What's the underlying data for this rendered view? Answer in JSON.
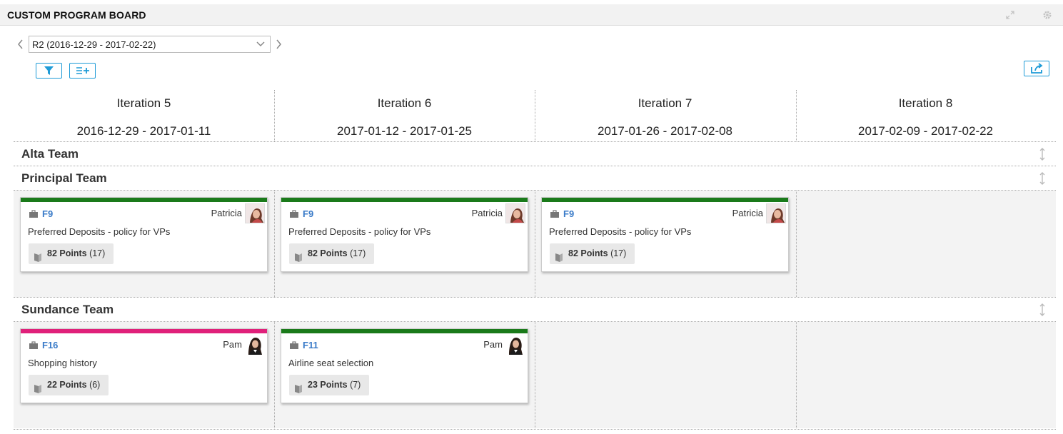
{
  "window": {
    "title": "CUSTOM PROGRAM BOARD",
    "expand_icon": "expand-icon",
    "settings_icon": "gear-icon"
  },
  "release": {
    "selected": "R2 (2016-12-29 - 2017-02-22)",
    "prev_icon": "chevron-left-icon",
    "next_icon": "chevron-right-icon"
  },
  "toolbar": {
    "filter_icon": "filter-icon",
    "add_row_icon": "add-list-icon",
    "share_icon": "share-icon",
    "accent_color": "#1e9bd7"
  },
  "iterations": [
    {
      "name": "Iteration 5",
      "dates": "2016-12-29 - 2017-01-11"
    },
    {
      "name": "Iteration 6",
      "dates": "2017-01-12 - 2017-01-25"
    },
    {
      "name": "Iteration 7",
      "dates": "2017-01-26 - 2017-02-08"
    },
    {
      "name": "Iteration 8",
      "dates": "2017-02-09 - 2017-02-22"
    }
  ],
  "teams": [
    {
      "name": "Alta Team",
      "cards": []
    },
    {
      "name": "Principal Team",
      "cards": [
        {
          "iteration": 0,
          "id": "F9",
          "owner": "Patricia",
          "title": "Preferred Deposits - policy for VPs",
          "points": "82 Points",
          "count": "(17)",
          "color": "#1a7a1a"
        },
        {
          "iteration": 1,
          "id": "F9",
          "owner": "Patricia",
          "title": "Preferred Deposits - policy for VPs",
          "points": "82 Points",
          "count": "(17)",
          "color": "#1a7a1a"
        },
        {
          "iteration": 2,
          "id": "F9",
          "owner": "Patricia",
          "title": "Preferred Deposits - policy for VPs",
          "points": "82 Points",
          "count": "(17)",
          "color": "#1a7a1a"
        }
      ]
    },
    {
      "name": "Sundance Team",
      "cards": [
        {
          "iteration": 0,
          "id": "F16",
          "owner": "Pam",
          "title": "Shopping history",
          "points": "22 Points",
          "count": "(6)",
          "color": "#e0207a"
        },
        {
          "iteration": 1,
          "id": "F11",
          "owner": "Pam",
          "title": "Airline seat selection",
          "points": "23 Points",
          "count": "(7)",
          "color": "#1a7a1a"
        }
      ]
    }
  ]
}
